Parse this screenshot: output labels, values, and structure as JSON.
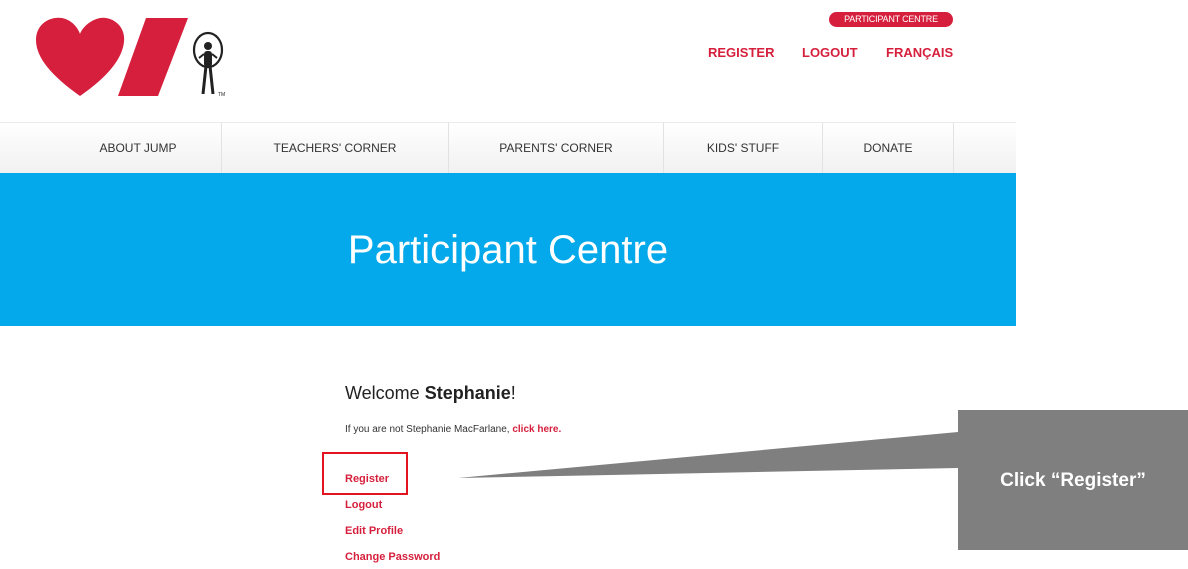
{
  "header": {
    "logo_icon": "heart-and-stroke-jump-rope-logo-icon",
    "badge_label": "PARTICIPANT CENTRE",
    "links": [
      "REGISTER",
      "LOGOUT",
      "FRANÇAIS"
    ]
  },
  "nav": {
    "items": [
      "ABOUT JUMP",
      "TEACHERS' CORNER",
      "PARENTS' CORNER",
      "KIDS' STUFF",
      "DONATE"
    ]
  },
  "hero": {
    "title": "Participant Centre"
  },
  "main": {
    "welcome_prefix": "Welcome ",
    "welcome_name": "Stephanie",
    "welcome_suffix": "!",
    "notice_text": "If you are not Stephanie MacFarlane, ",
    "notice_link": "click here.",
    "links": [
      "Register",
      "Logout",
      "Edit Profile",
      "Change Password"
    ]
  },
  "annotation": {
    "callout_text": "Click “Register”"
  },
  "colors": {
    "accent_red": "#d61f3c",
    "hero_blue": "#03a9ea",
    "callout_gray": "#7f7f7f",
    "highlight_red": "#e2141f"
  }
}
